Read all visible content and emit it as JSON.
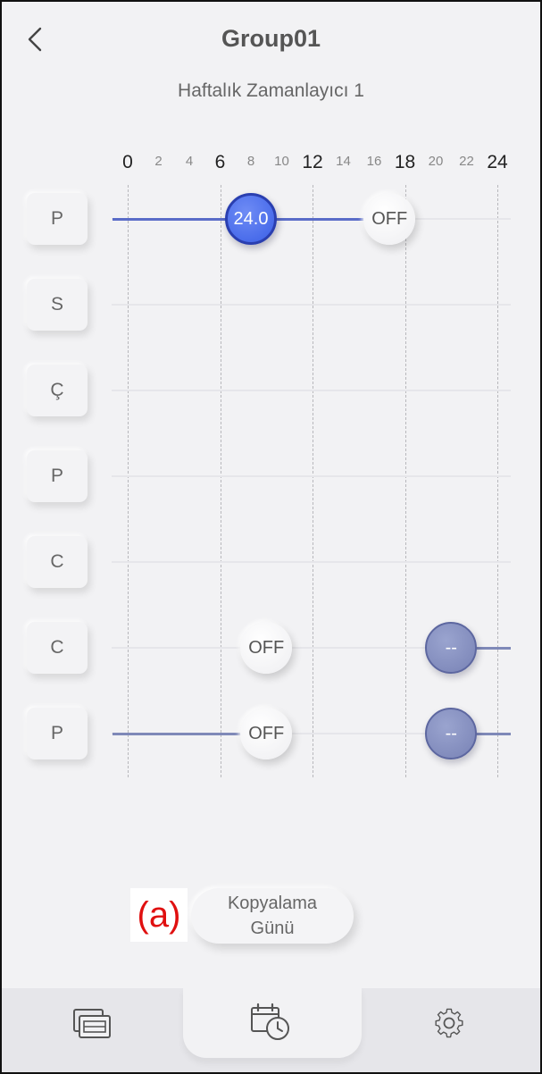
{
  "header": {
    "title": "Group01",
    "subtitle": "Haftalık Zamanlayıcı 1"
  },
  "axis": {
    "ticks": [
      {
        "label": "0",
        "hour": 0,
        "major": true
      },
      {
        "label": "2",
        "hour": 2,
        "major": false
      },
      {
        "label": "4",
        "hour": 4,
        "major": false
      },
      {
        "label": "6",
        "hour": 6,
        "major": true
      },
      {
        "label": "8",
        "hour": 8,
        "major": false
      },
      {
        "label": "10",
        "hour": 10,
        "major": false
      },
      {
        "label": "12",
        "hour": 12,
        "major": true
      },
      {
        "label": "14",
        "hour": 14,
        "major": false
      },
      {
        "label": "16",
        "hour": 16,
        "major": false
      },
      {
        "label": "18",
        "hour": 18,
        "major": true
      },
      {
        "label": "20",
        "hour": 20,
        "major": false
      },
      {
        "label": "22",
        "hour": 22,
        "major": false
      },
      {
        "label": "24",
        "hour": 24,
        "major": true
      }
    ]
  },
  "days": [
    {
      "label": "P",
      "segments": [
        {
          "from": -1,
          "to": 8,
          "style": "active"
        },
        {
          "from": 8,
          "to": 16,
          "style": "active"
        }
      ],
      "events": [
        {
          "hour": 8,
          "text": "24.0",
          "style": "active"
        },
        {
          "hour": 17,
          "text": "OFF",
          "style": "white"
        }
      ]
    },
    {
      "label": "S",
      "segments": [],
      "events": []
    },
    {
      "label": "Ç",
      "segments": [],
      "events": []
    },
    {
      "label": "P",
      "segments": [],
      "events": []
    },
    {
      "label": "C",
      "segments": [],
      "events": []
    },
    {
      "label": "C",
      "segments": [
        {
          "from": 21,
          "to": 25,
          "style": "grey"
        }
      ],
      "events": [
        {
          "hour": 9,
          "text": "OFF",
          "style": "white"
        },
        {
          "hour": 21,
          "text": "--",
          "style": "empty"
        }
      ]
    },
    {
      "label": "P",
      "segments": [
        {
          "from": -1,
          "to": 9,
          "style": "grey"
        },
        {
          "from": 21,
          "to": 25,
          "style": "grey"
        }
      ],
      "events": [
        {
          "hour": 9,
          "text": "OFF",
          "style": "white"
        },
        {
          "hour": 21,
          "text": "--",
          "style": "empty"
        }
      ]
    }
  ],
  "annotation": {
    "label": "(a)",
    "color": "#e01010"
  },
  "copy_button": {
    "line1": "Kopyalama",
    "line2": "Günü"
  },
  "nav": {
    "items": [
      {
        "icon": "devices-icon"
      },
      {
        "icon": "calendar-clock-icon"
      },
      {
        "icon": "gear-icon"
      }
    ]
  },
  "colors": {
    "accent": "#3a5fe6",
    "inactive_knob": "#7882b5",
    "background": "#f2f2f4"
  }
}
